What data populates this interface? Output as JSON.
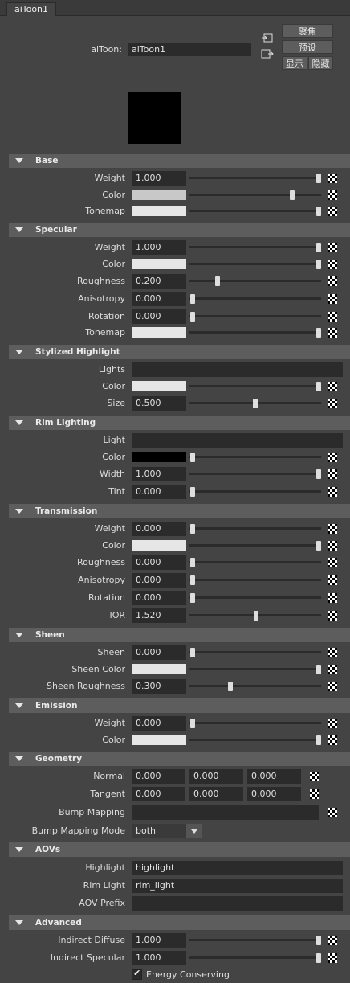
{
  "tab": "aiToon1",
  "header": {
    "label": "aiToon:",
    "name": "aiToon1",
    "buttons": {
      "focus": "聚焦",
      "presets": "预设",
      "show": "显示",
      "hide": "隐藏"
    }
  },
  "swatch_color": "#000000",
  "sections": {
    "base": {
      "title": "Base",
      "weight_label": "Weight",
      "weight": "1.000",
      "color_label": "Color",
      "tonemap_label": "Tonemap"
    },
    "specular": {
      "title": "Specular",
      "weight_label": "Weight",
      "weight": "1.000",
      "color_label": "Color",
      "roughness_label": "Roughness",
      "roughness": "0.200",
      "anisotropy_label": "Anisotropy",
      "anisotropy": "0.000",
      "rotation_label": "Rotation",
      "rotation": "0.000",
      "tonemap_label": "Tonemap"
    },
    "stylized": {
      "title": "Stylized Highlight",
      "lights_label": "Lights",
      "lights": "",
      "color_label": "Color",
      "size_label": "Size",
      "size": "0.500"
    },
    "rim": {
      "title": "Rim Lighting",
      "light_label": "Light",
      "light": "",
      "color_label": "Color",
      "width_label": "Width",
      "width": "1.000",
      "tint_label": "Tint",
      "tint": "0.000"
    },
    "transmission": {
      "title": "Transmission",
      "weight_label": "Weight",
      "weight": "0.000",
      "color_label": "Color",
      "roughness_label": "Roughness",
      "roughness": "0.000",
      "anisotropy_label": "Anisotropy",
      "anisotropy": "0.000",
      "rotation_label": "Rotation",
      "rotation": "0.000",
      "ior_label": "IOR",
      "ior": "1.520"
    },
    "sheen": {
      "title": "Sheen",
      "sheen_label": "Sheen",
      "sheen": "0.000",
      "color_label": "Sheen Color",
      "roughness_label": "Sheen Roughness",
      "roughness": "0.300"
    },
    "emission": {
      "title": "Emission",
      "weight_label": "Weight",
      "weight": "0.000",
      "color_label": "Color"
    },
    "geometry": {
      "title": "Geometry",
      "normal_label": "Normal",
      "normal": [
        "0.000",
        "0.000",
        "0.000"
      ],
      "tangent_label": "Tangent",
      "tangent": [
        "0.000",
        "0.000",
        "0.000"
      ],
      "bump_label": "Bump Mapping",
      "bump": "",
      "bump_mode_label": "Bump Mapping Mode",
      "bump_mode": "both"
    },
    "aovs": {
      "title": "AOVs",
      "highlight_label": "Highlight",
      "highlight": "highlight",
      "rim_label": "Rim Light",
      "rim": "rim_light",
      "prefix_label": "AOV Prefix",
      "prefix": ""
    },
    "advanced": {
      "title": "Advanced",
      "indirect_diffuse_label": "Indirect Diffuse",
      "indirect_diffuse": "1.000",
      "indirect_specular_label": "Indirect Specular",
      "indirect_specular": "1.000",
      "energy_label": "Energy Conserving",
      "energy": true
    }
  }
}
